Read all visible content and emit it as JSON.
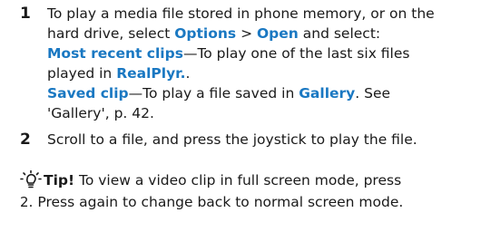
{
  "step1": {
    "number": "1",
    "line1": "To play a media file stored in phone memory, or on the",
    "line2_a": "hard drive, select ",
    "options": "Options",
    "sep": " > ",
    "open": "Open",
    "line2_b": " and select:",
    "most_recent": "Most recent clips",
    "most_recent_desc": "—To play one of the last six files",
    "line4_a": "played in ",
    "realplayer": "RealPlyr.",
    "line4_b": ".",
    "saved_clip": "Saved clip",
    "saved_clip_desc": "—To play a file saved in ",
    "gallery": "Gallery",
    "saved_clip_end": ". See",
    "line6": "'Gallery', p. 42."
  },
  "step2": {
    "number": "2",
    "text": "Scroll to a file, and press the joystick to play the file."
  },
  "tip": {
    "icon": "tip-icon",
    "label": "Tip!",
    "line1": " To view a video clip in full screen mode, press",
    "key": "2",
    "line2": ". Press again to change back to normal screen mode."
  },
  "colors": {
    "highlight": "#1a78c2",
    "text": "#1a1a1a"
  }
}
